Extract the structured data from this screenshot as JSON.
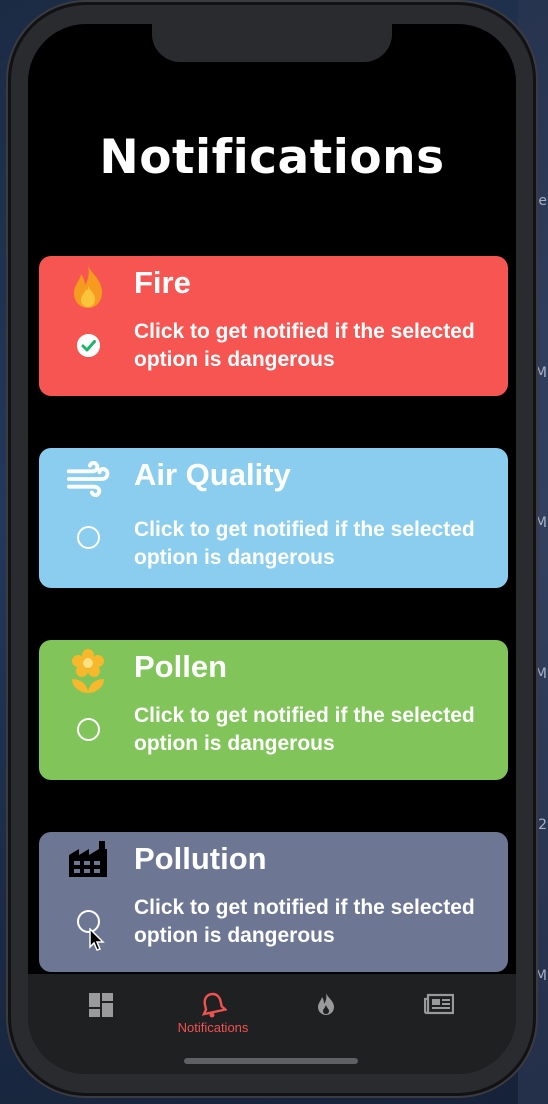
{
  "page": {
    "title": "Notifications"
  },
  "cards": [
    {
      "title": "Fire",
      "description": "Click to get notified if the selected option is dangerous",
      "icon": "fire-icon",
      "color": "#f65552",
      "checked": true
    },
    {
      "title": "Air Quality",
      "description": "Click to get notified if the selected option is dangerous",
      "icon": "wind-icon",
      "color": "#8bcdef",
      "checked": false
    },
    {
      "title": "Pollen",
      "description": "Click to get notified if the selected option is dangerous",
      "icon": "flower-icon",
      "color": "#80c45a",
      "checked": false
    },
    {
      "title": "Pollution",
      "description": "Click to get notified if the selected option is dangerous",
      "icon": "factory-icon",
      "color": "#6d7794",
      "checked": false
    }
  ],
  "tabbar": {
    "active_color": "#f0524f",
    "inactive_color": "#9a9a9c",
    "items": [
      {
        "icon": "dashboard-icon",
        "label": ""
      },
      {
        "icon": "bell-icon",
        "label": "Notifications"
      },
      {
        "icon": "flame-icon",
        "label": ""
      },
      {
        "icon": "news-icon",
        "label": ""
      }
    ]
  }
}
